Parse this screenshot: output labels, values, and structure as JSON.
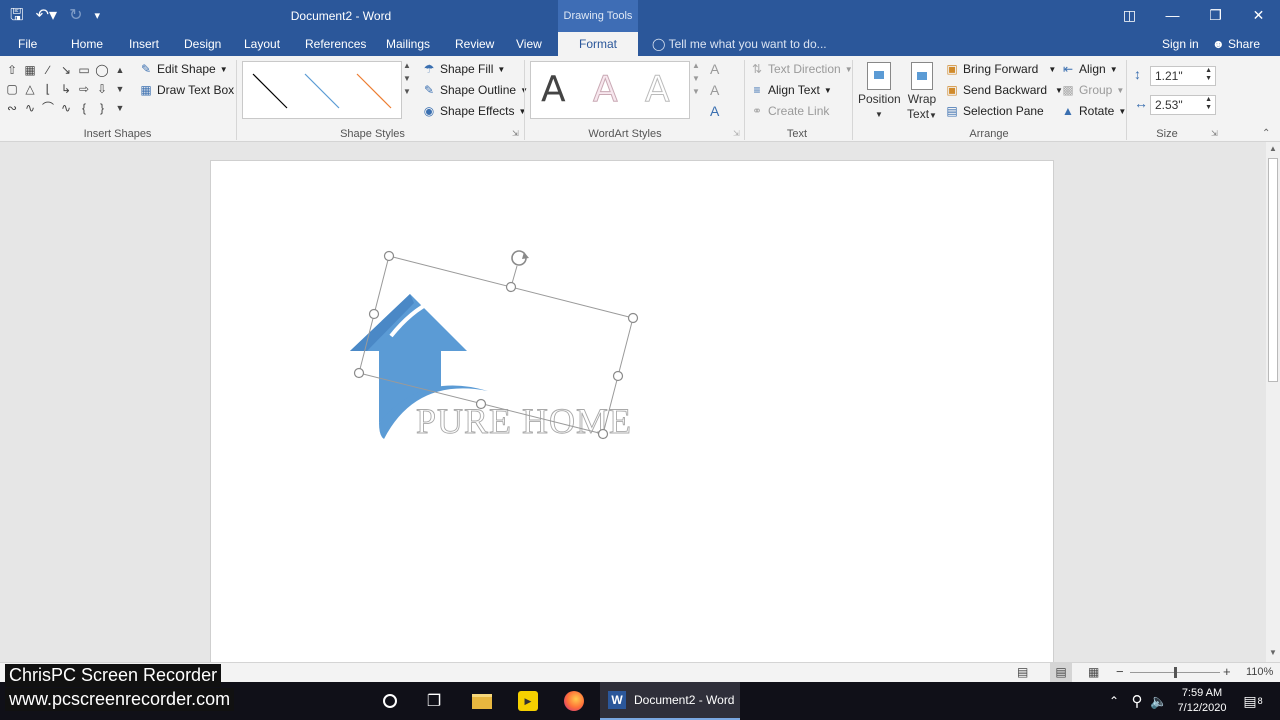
{
  "titlebar": {
    "title": "Document2 - Word",
    "context_tab_group": "Drawing Tools",
    "qat": {
      "save_icon": "save-icon",
      "undo_icon": "undo-icon",
      "redo_icon": "redo-icon",
      "customize_icon": "chevron-down-icon"
    },
    "window_buttons": [
      "ribbon-display-icon",
      "minimize-icon",
      "restore-icon",
      "close-icon"
    ]
  },
  "tabs": {
    "items": [
      "File",
      "Home",
      "Insert",
      "Design",
      "Layout",
      "References",
      "Mailings",
      "Review",
      "View",
      "Format"
    ],
    "active": "Format",
    "tell_me": "Tell me what you want to do...",
    "sign_in": "Sign in",
    "share": "Share"
  },
  "ribbon": {
    "insert_shapes": {
      "label": "Insert Shapes",
      "edit_shape": "Edit Shape",
      "draw_text_box": "Draw Text Box"
    },
    "shape_styles": {
      "label": "Shape Styles",
      "shape_fill": "Shape Fill",
      "shape_outline": "Shape Outline",
      "shape_effects": "Shape Effects"
    },
    "wordart_styles": {
      "label": "WordArt Styles",
      "sample": "A"
    },
    "text": {
      "label": "Text",
      "text_direction": "Text Direction",
      "align_text": "Align Text",
      "create_link": "Create Link"
    },
    "arrange": {
      "label": "Arrange",
      "position": "Position",
      "wrap_text_1": "Wrap",
      "wrap_text_2": "Text",
      "bring_forward": "Bring Forward",
      "send_backward": "Send Backward",
      "selection_pane": "Selection Pane",
      "align": "Align",
      "group": "Group",
      "rotate": "Rotate"
    },
    "size": {
      "label": "Size",
      "height": "1.21\"",
      "width": "2.53\""
    }
  },
  "document": {
    "logo_text": "PURE HOME"
  },
  "statusbar": {
    "zoom": "110%"
  },
  "taskbar": {
    "word_button": "Document2 - Word",
    "time": "7:59 AM",
    "date": "7/12/2020",
    "notification_count": "8"
  },
  "watermark": {
    "line1": "ChrisPC Screen Recorder",
    "line2": "www.pcscreenrecorder.com"
  },
  "colors": {
    "word_blue": "#2b579a",
    "logo_blue": "#5b9bd5",
    "ribbon_bg": "#f3f3f3"
  }
}
